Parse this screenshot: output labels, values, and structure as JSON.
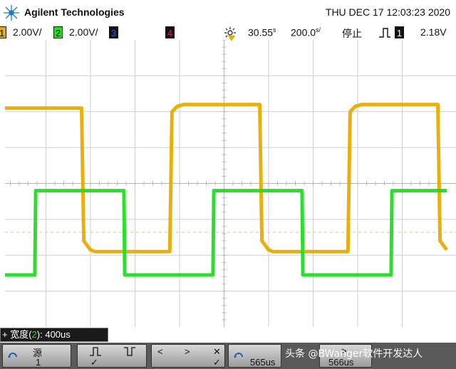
{
  "header": {
    "brand": "Agilent Technologies",
    "datetime": "THU DEC 17 12:03:23 2020"
  },
  "status": {
    "ch1": {
      "num": "1",
      "scale": "2.00V/",
      "color": "#e8ac00"
    },
    "ch2": {
      "num": "2",
      "scale": "2.00V/",
      "color": "#22dd22"
    },
    "ch3": {
      "num": "3",
      "color": "#2a66ff"
    },
    "ch4": {
      "num": "4",
      "color": "#dd2255"
    },
    "delay": "30.55",
    "delay_unit": "s",
    "timebase": "200.0",
    "timebase_unit": "s/",
    "run_state": "停止",
    "trig_source": "1",
    "trig_level": "2.18V"
  },
  "measurement": {
    "prefix": "+ 宽度(",
    "channel": "2",
    "suffix": "): 400us"
  },
  "softkeys": {
    "source_label": "源",
    "source_value": "1",
    "check_a": "✓",
    "check_b": "✓",
    "lt": "<",
    "gt": ">",
    "close": "✕",
    "check_c": "✓",
    "lt_value": "565us",
    "gt_label": ">",
    "gt_value": "566us"
  },
  "watermark": "头条 @BWanger软件开发达人",
  "icons": {
    "logo": "agilent-spark-icon",
    "trigger": "trigger-sun-icon",
    "edge": "rising-edge-icon"
  },
  "chart_data": {
    "type": "line",
    "title": "",
    "xlabel": "",
    "ylabel": "",
    "grid": true,
    "x_divisions": 10,
    "y_divisions": 8,
    "xlim": [
      0,
      10
    ],
    "ylim": [
      -4,
      4
    ],
    "series": [
      {
        "channel": "1",
        "color": "#e8ac00",
        "x": [
          0,
          1.8,
          1.85,
          2.0,
          2.1,
          3.78,
          3.83,
          3.95,
          4.1,
          5.8,
          5.85,
          6.0,
          6.1,
          7.78,
          7.83,
          7.95,
          8.1,
          9.8,
          9.85,
          10.0
        ],
        "y": [
          2.1,
          2.1,
          -1.6,
          -1.85,
          -1.9,
          -1.9,
          2.0,
          2.15,
          2.2,
          2.2,
          -1.6,
          -1.85,
          -1.9,
          -1.9,
          2.0,
          2.15,
          2.2,
          2.2,
          -1.6,
          -1.85
        ]
      },
      {
        "channel": "2",
        "color": "#22dd22",
        "x": [
          0,
          0.75,
          0.77,
          2.75,
          2.77,
          4.75,
          4.77,
          6.75,
          6.77,
          8.75,
          8.77,
          10.0
        ],
        "y": [
          -2.55,
          -2.55,
          -0.2,
          -0.2,
          -2.55,
          -2.55,
          -0.2,
          -0.2,
          -2.55,
          -2.55,
          -0.2,
          -0.2
        ]
      }
    ]
  }
}
